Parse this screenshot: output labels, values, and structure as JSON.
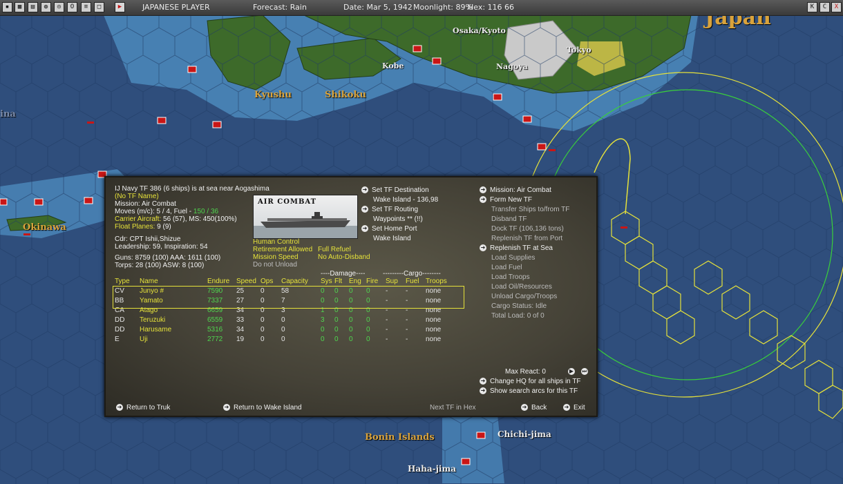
{
  "topbar": {
    "player": "JAPANESE PLAYER",
    "forecast": "Forecast: Rain",
    "date": "Date: Mar 5, 1942",
    "moonlight": "Moonlight: 89%",
    "hex": "Hex: 116 66",
    "right_buttons": [
      "K",
      "C",
      "X"
    ]
  },
  "map": {
    "labels": {
      "japan": "Japan",
      "osaka": "Osaka/Kyoto",
      "tokyo": "Tokyo",
      "kobe": "Kobe",
      "nagoya": "Nagoya",
      "kyushu": "Kyushu",
      "shikoku": "Shikoku",
      "okinawa": "Okinawa",
      "bonin": "Bonin Islands",
      "chichi": "Chichi-jima",
      "haha": "Haha-jima",
      "ina": "ina"
    },
    "colors": {
      "sea": "#2f4e7c",
      "shallow": "#4a86b8",
      "land": "#3d6a2a",
      "city": "#c9c9c9",
      "range_yellow": "#e6e23a",
      "range_green": "#3ad13a"
    }
  },
  "panel": {
    "header": "IJ Navy TF 386 (6 ships) is at sea near Aogashima",
    "tf_name": "(No TF Name)",
    "mission": "Mission: Air Combat",
    "moves_prefix": "Moves (m/c): 5 / 4, Fuel - ",
    "moves_fuel": "150 / 36",
    "carrier_label": "Carrier Aircraft:",
    "carrier_value": " 56 (57), MS: 450(100%)",
    "float_label": "Float Planes:",
    "float_value": " 9 (9)",
    "cdr": "Cdr: CPT Ishii,Shizue",
    "leadership": "Leadership: 59, Inspiration: 54",
    "guns": "Guns: 8759 (100)   AAA: 1611 (100)",
    "torps": "Torps: 28 (100)     ASW: 8 (100)",
    "photo_caption": "AIR COMBAT",
    "control": {
      "human": "Human Control",
      "retire": "Retirement Allowed",
      "refuel": "Full Refuel",
      "speed": "Mission Speed",
      "disband": "No Auto-Disband",
      "unload": "Do not Unload"
    },
    "col2": {
      "set_dest": "Set TF Destination",
      "dest_value": "Wake Island - 136,98",
      "set_routing": "Set TF Routing",
      "waypoints": "Waypoints ** (!!)",
      "set_home": "Set Home Port",
      "home_value": "Wake Island"
    },
    "col3": {
      "mission": "Mission: Air Combat",
      "form": "Form New TF",
      "transfer": "Transfer Ships to/from TF",
      "disband": "Disband TF",
      "dock": "Dock TF (106,136 tons)",
      "replenish_port": "Replenish TF from Port",
      "replenish_sea": "Replenish TF at Sea",
      "load_supplies": "Load Supplies",
      "load_fuel": "Load Fuel",
      "load_troops": "Load Troops",
      "load_oil": "Load Oil/Resources",
      "unload_cargo": "Unload Cargo/Troops",
      "cargo_status": "Cargo Status: Idle",
      "total_load": "Total Load: 0 of 0"
    },
    "table": {
      "group_damage": "----Damage----",
      "group_cargo": "---------Cargo--------",
      "headers": [
        "Type",
        "Name",
        "Endure",
        "Speed",
        "Ops",
        "Capacity",
        "Sys",
        "Flt",
        "Eng",
        "Fire",
        "Sup",
        "Fuel",
        "Troops"
      ],
      "rows": [
        {
          "type": "CV",
          "name": "Junyo #",
          "endure": "7590",
          "speed": "25",
          "ops": "0",
          "capacity": "58",
          "sys": "0",
          "flt": "0",
          "eng": "0",
          "fire": "0",
          "sup": "-",
          "fuel": "-",
          "troops": "none"
        },
        {
          "type": "BB",
          "name": "Yamato",
          "endure": "7337",
          "speed": "27",
          "ops": "0",
          "capacity": "7",
          "sys": "0",
          "flt": "0",
          "eng": "0",
          "fire": "0",
          "sup": "-",
          "fuel": "-",
          "troops": "none"
        },
        {
          "type": "CA",
          "name": "Atago",
          "endure": "6659",
          "speed": "34",
          "ops": "0",
          "capacity": "3",
          "sys": "1",
          "flt": "0",
          "eng": "0",
          "fire": "0",
          "sup": "-",
          "fuel": "-",
          "troops": "none"
        },
        {
          "type": "DD",
          "name": "Teruzuki",
          "endure": "6559",
          "speed": "33",
          "ops": "0",
          "capacity": "0",
          "sys": "3",
          "flt": "0",
          "eng": "0",
          "fire": "0",
          "sup": "-",
          "fuel": "-",
          "troops": "none"
        },
        {
          "type": "DD",
          "name": "Harusame",
          "endure": "5316",
          "speed": "34",
          "ops": "0",
          "capacity": "0",
          "sys": "0",
          "flt": "0",
          "eng": "0",
          "fire": "0",
          "sup": "-",
          "fuel": "-",
          "troops": "none"
        },
        {
          "type": "E",
          "name": "Uji",
          "endure": "2772",
          "speed": "19",
          "ops": "0",
          "capacity": "0",
          "sys": "0",
          "flt": "0",
          "eng": "0",
          "fire": "0",
          "sup": "-",
          "fuel": "-",
          "troops": "none"
        }
      ]
    },
    "max_react": "Max React:  0",
    "change_hq": "Change HQ for all ships in TF",
    "show_search": "Show search arcs for this TF",
    "return_truk": "Return to Truk",
    "return_wake": "Return to Wake Island",
    "next_tf": "Next TF in Hex",
    "back": "Back",
    "exit": "Exit"
  }
}
